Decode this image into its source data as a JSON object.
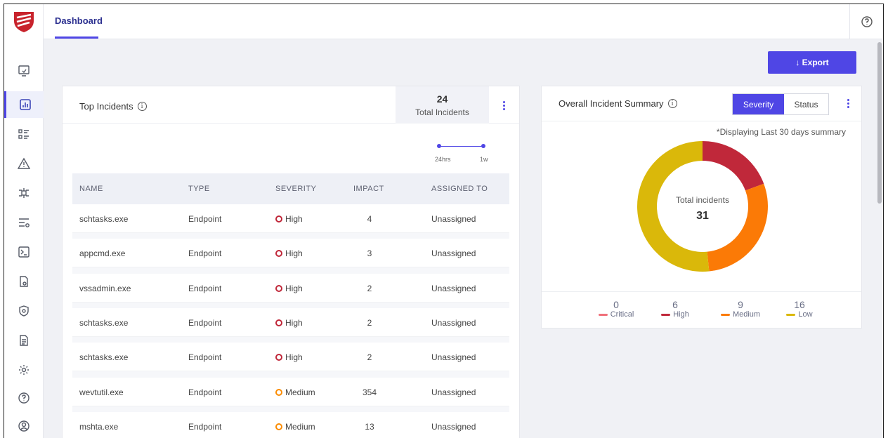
{
  "topbar": {
    "tab": "Dashboard"
  },
  "toolbar": {
    "export_label": "↓ Export"
  },
  "top_incidents": {
    "title": "Top Incidents",
    "total_count": "24",
    "total_label": "Total Incidents",
    "range_labels": [
      "24hrs",
      "1w"
    ],
    "columns": [
      "NAME",
      "TYPE",
      "SEVERITY",
      "IMPACT",
      "ASSIGNED TO"
    ],
    "rows": [
      {
        "name": "schtasks.exe",
        "type": "Endpoint",
        "severity": "High",
        "impact": "4",
        "assigned": "Unassigned"
      },
      {
        "name": "appcmd.exe",
        "type": "Endpoint",
        "severity": "High",
        "impact": "3",
        "assigned": "Unassigned"
      },
      {
        "name": "vssadmin.exe",
        "type": "Endpoint",
        "severity": "High",
        "impact": "2",
        "assigned": "Unassigned"
      },
      {
        "name": "schtasks.exe",
        "type": "Endpoint",
        "severity": "High",
        "impact": "2",
        "assigned": "Unassigned"
      },
      {
        "name": "schtasks.exe",
        "type": "Endpoint",
        "severity": "High",
        "impact": "2",
        "assigned": "Unassigned"
      },
      {
        "name": "wevtutil.exe",
        "type": "Endpoint",
        "severity": "Medium",
        "impact": "354",
        "assigned": "Unassigned"
      },
      {
        "name": "mshta.exe",
        "type": "Endpoint",
        "severity": "Medium",
        "impact": "13",
        "assigned": "Unassigned"
      }
    ]
  },
  "summary": {
    "title": "Overall Incident Summary",
    "toggle_on": "Severity",
    "toggle_off": "Status",
    "note": "*Displaying Last 30 days summary",
    "center_label": "Total incidents",
    "center_value": "31",
    "legend": [
      {
        "label": "Critical",
        "value": "0",
        "color": "#f0707a"
      },
      {
        "label": "High",
        "value": "6",
        "color": "#c0283a"
      },
      {
        "label": "Medium",
        "value": "9",
        "color": "#fb7a06"
      },
      {
        "label": "Low",
        "value": "16",
        "color": "#dab80a"
      }
    ]
  },
  "severity_colors": {
    "High": "#c0283a",
    "Medium": "#fb8c00"
  }
}
